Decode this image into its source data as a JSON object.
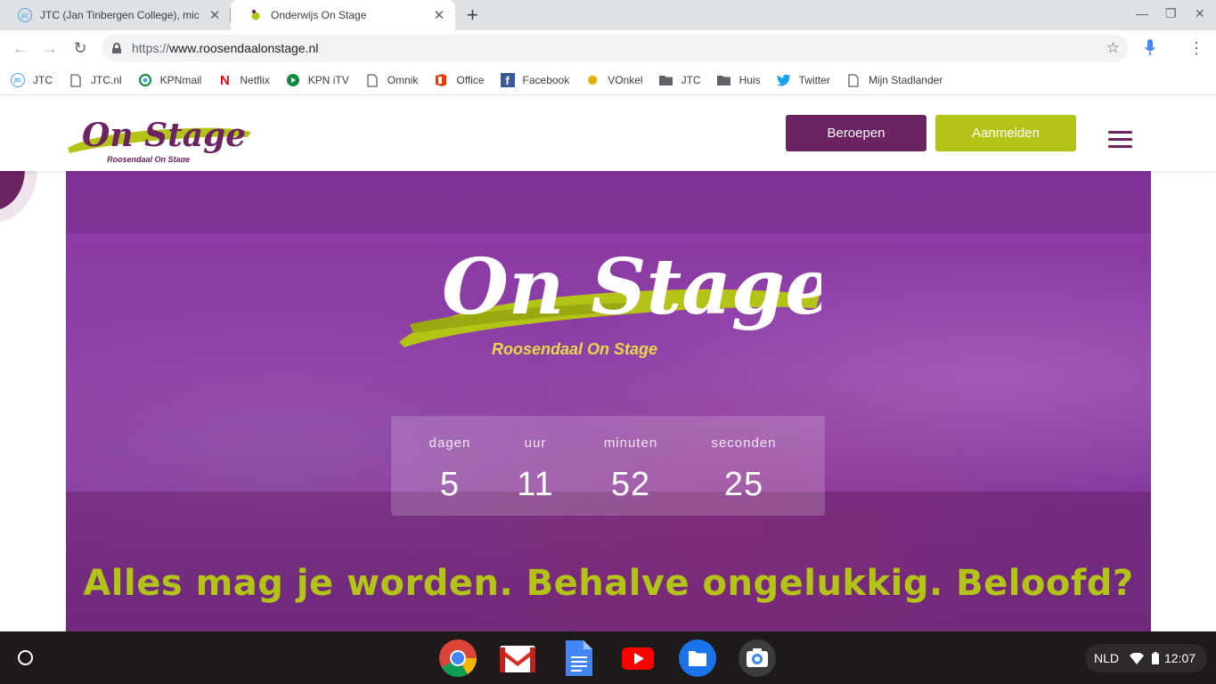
{
  "browser": {
    "tabs": [
      {
        "title": "JTC (Jan Tinbergen College), mic",
        "active": false,
        "favicon": "jtc-icon"
      },
      {
        "title": "Onderwijs On Stage",
        "active": true,
        "favicon": "onstage-icon"
      }
    ],
    "new_tab_label": "+",
    "url_scheme": "https://",
    "url_host": "www.roosendaalonstage.nl"
  },
  "bookmarks": [
    {
      "label": "JTC",
      "icon": "jtc-icon",
      "color": "#4aa3df"
    },
    {
      "label": "JTC.nl",
      "icon": "page-icon",
      "color": "#5f6368"
    },
    {
      "label": "KPNmail",
      "icon": "kpn-icon",
      "color": "#0c8a3c"
    },
    {
      "label": "Netflix",
      "icon": "netflix-icon",
      "color": "#e50914"
    },
    {
      "label": "KPN iTV",
      "icon": "kpn-itv-icon",
      "color": "#0c8a3c"
    },
    {
      "label": "Omnik",
      "icon": "page-icon",
      "color": "#5f6368"
    },
    {
      "label": "Office",
      "icon": "office-icon",
      "color": "#eb3c00"
    },
    {
      "label": "Facebook",
      "icon": "facebook-icon",
      "color": "#3b5998"
    },
    {
      "label": "VOnkel",
      "icon": "sun-icon",
      "color": "#e0b000"
    },
    {
      "label": "JTC",
      "icon": "folder-icon",
      "color": "#5f6368"
    },
    {
      "label": "Huis",
      "icon": "folder-icon",
      "color": "#5f6368"
    },
    {
      "label": "Twitter",
      "icon": "twitter-icon",
      "color": "#1da1f2"
    },
    {
      "label": "Mijn Stadlander",
      "icon": "page-icon",
      "color": "#5f6368"
    }
  ],
  "site": {
    "logo_title": "On Stage",
    "logo_subtitle": "Roosendaal On Stage",
    "buttons": {
      "beroepen": "Beroepen",
      "aanmelden": "Aanmelden"
    },
    "colors": {
      "purple": "#6b2362",
      "lime": "#b4c417"
    }
  },
  "hero": {
    "logo_title": "On Stage",
    "logo_subtitle": "Roosendaal On Stage",
    "countdown": [
      {
        "label": "dagen",
        "value": "5"
      },
      {
        "label": "uur",
        "value": "11"
      },
      {
        "label": "minuten",
        "value": "52"
      },
      {
        "label": "seconden",
        "value": "25"
      }
    ],
    "tagline": "Alles mag je worden. Behalve ongelukkig. Beloofd?"
  },
  "shelf": {
    "apps": [
      "chrome-icon",
      "gmail-icon",
      "docs-icon",
      "youtube-icon",
      "files-icon",
      "camera-icon"
    ],
    "keyboard_layout": "NLD",
    "time": "12:07"
  }
}
